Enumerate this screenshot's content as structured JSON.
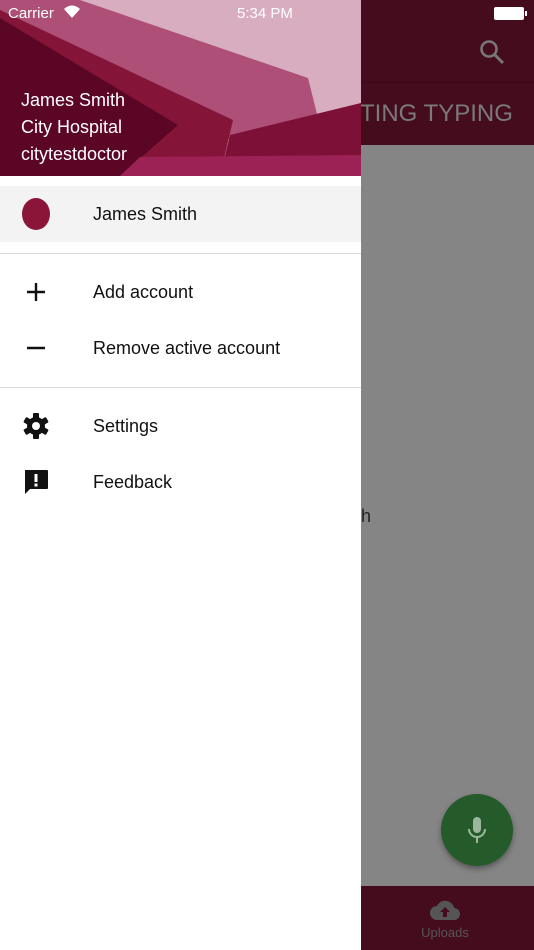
{
  "status_bar": {
    "carrier": "Carrier",
    "time": "5:34 PM"
  },
  "background": {
    "tab_label": "TING TYPING",
    "stray_text": "h",
    "bottom_tab": "Uploads"
  },
  "drawer": {
    "header": {
      "name": "James Smith",
      "organization": "City Hospital",
      "username": "citytestdoctor"
    },
    "accounts": [
      {
        "label": "James Smith"
      }
    ],
    "actions": [
      {
        "label": "Add account",
        "icon": "plus-icon"
      },
      {
        "label": "Remove active account",
        "icon": "minus-icon"
      }
    ],
    "menu": [
      {
        "label": "Settings",
        "icon": "gear-icon"
      },
      {
        "label": "Feedback",
        "icon": "feedback-icon"
      }
    ]
  },
  "colors": {
    "brand": "#8a1538",
    "app_header": "#450c1e",
    "fab": "#255a2b"
  }
}
